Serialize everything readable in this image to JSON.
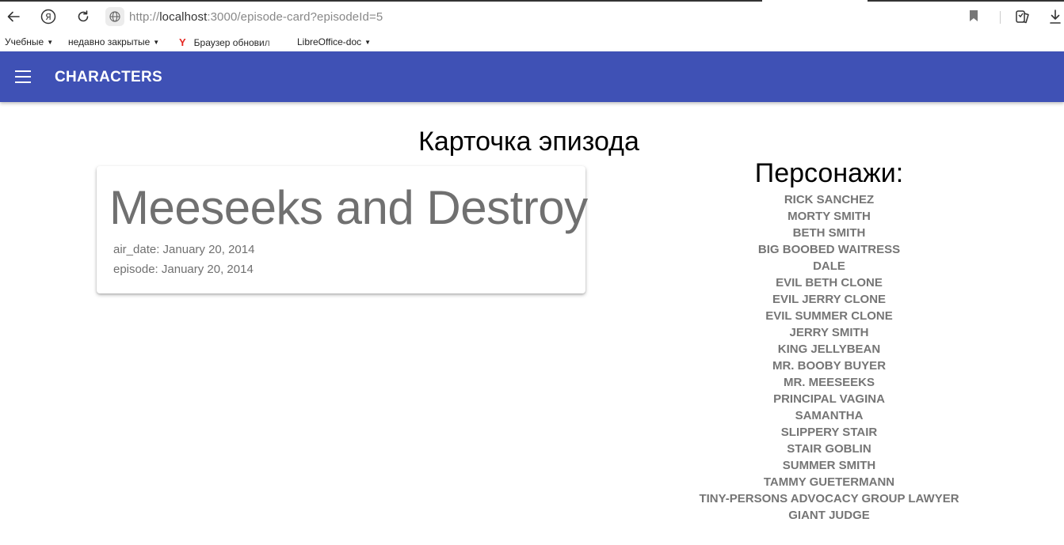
{
  "browser": {
    "url_prefix": "http://",
    "url_host": "localhost",
    "url_rest": ":3000/episode-card?episodeId=5",
    "bookmarks": [
      {
        "label": "Учебные"
      },
      {
        "label": "недавно закрытые"
      },
      {
        "label": "Браузер обновил"
      },
      {
        "label": "LibreOffice-doc"
      }
    ]
  },
  "appbar": {
    "title": "CHARACTERS",
    "color": "#3f51b5"
  },
  "main": {
    "page_title": "Карточка эпизода",
    "card": {
      "title": "Meeseeks and Destroy",
      "air_date": "air_date: January 20, 2014",
      "episode": "episode: January 20, 2014"
    },
    "characters_title": "Персонажи:",
    "characters": [
      "RICK SANCHEZ",
      "MORTY SMITH",
      "BETH SMITH",
      "BIG BOOBED WAITRESS",
      "DALE",
      "EVIL BETH CLONE",
      "EVIL JERRY CLONE",
      "EVIL SUMMER CLONE",
      "JERRY SMITH",
      "KING JELLYBEAN",
      "MR. BOOBY BUYER",
      "MR. MEESEEKS",
      "PRINCIPAL VAGINA",
      "SAMANTHA",
      "SLIPPERY STAIR",
      "STAIR GOBLIN",
      "SUMMER SMITH",
      "TAMMY GUETERMANN",
      "TINY-PERSONS ADVOCACY GROUP LAWYER",
      "GIANT JUDGE"
    ]
  }
}
